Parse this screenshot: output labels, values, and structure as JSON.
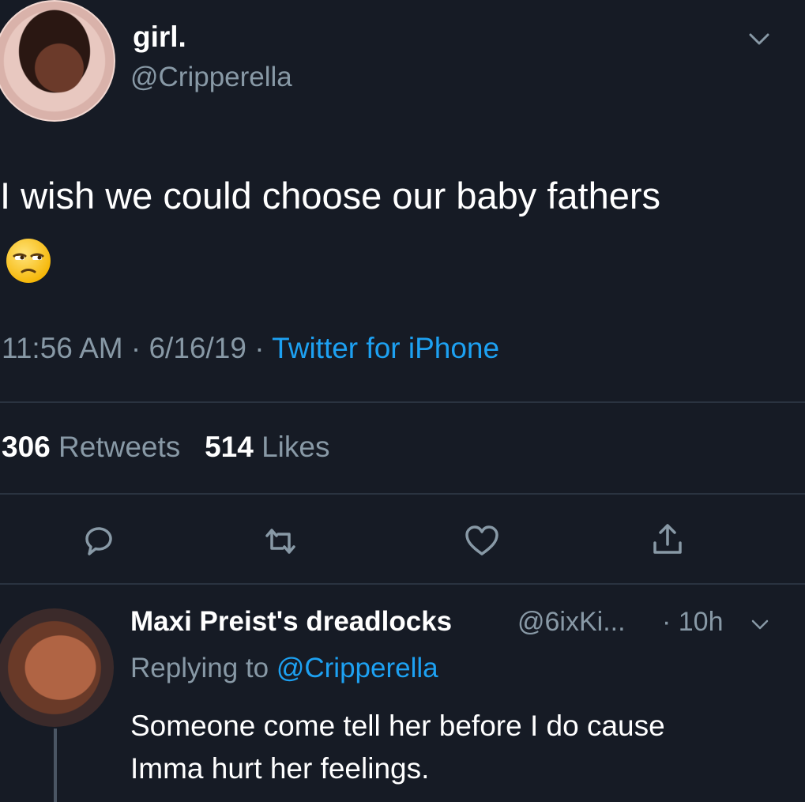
{
  "tweet": {
    "display_name": "girl.",
    "handle": "@Cripperella",
    "text": "I wish we could choose our baby fathers",
    "emoji": "😒",
    "time": "11:56 AM",
    "date": "6/16/19",
    "sep": "·",
    "source": "Twitter for iPhone",
    "retweets_count": "306",
    "retweets_label": "Retweets",
    "likes_count": "514",
    "likes_label": "Likes",
    "avatar_icon": "profile-photo",
    "menu_icon": "chevron-down"
  },
  "actions": [
    {
      "icon": "reply-icon"
    },
    {
      "icon": "retweet-icon"
    },
    {
      "icon": "like-icon"
    },
    {
      "icon": "share-icon"
    }
  ],
  "reply": {
    "display_name": "Maxi Preist's dreadlocks",
    "handle": "@6ixKi...",
    "time": "· 10h",
    "replying_prefix": "Replying to",
    "replying_mention": "@Cripperella",
    "text_line1": "Someone come tell her before I do cause",
    "text_line2": "Imma hurt her feelings."
  },
  "colors": {
    "background": "#161b25",
    "secondary_text": "#8899a6",
    "link": "#1da1f2",
    "divider": "#2a3340"
  }
}
